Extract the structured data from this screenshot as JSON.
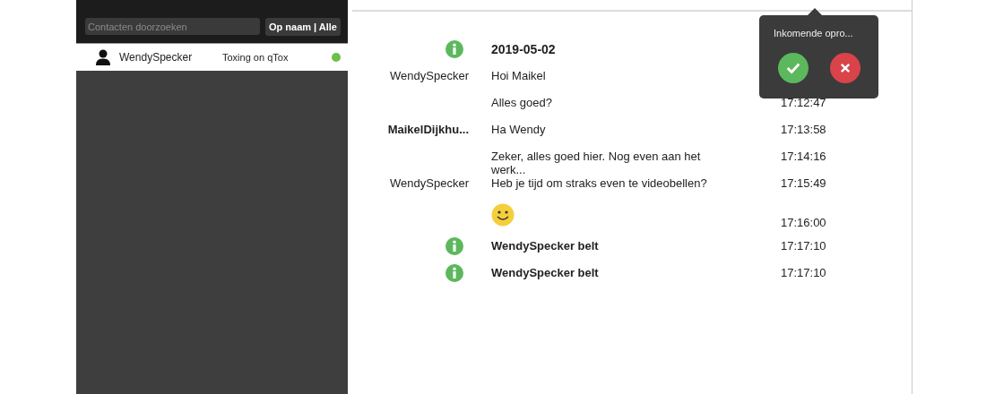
{
  "sidebar": {
    "search": {
      "placeholder": "Contacten doorzoeken"
    },
    "filter_button": "Op naam | Alle",
    "contacts": [
      {
        "name": "WendySpecker",
        "status": "Toxing on qTox",
        "online": true,
        "selected": true
      }
    ]
  },
  "chat": {
    "messages": [
      {
        "kind": "info",
        "text": "2019-05-02"
      },
      {
        "kind": "text",
        "sender": "WendySpecker",
        "self": false,
        "text": "Hoi Maikel"
      },
      {
        "kind": "text",
        "text": "Alles goed?",
        "time": "17:12:47"
      },
      {
        "kind": "text",
        "sender": "MaikelDijkhu...",
        "self": true,
        "text": "Ha Wendy",
        "time": "17:13:58"
      },
      {
        "kind": "text",
        "text": "Zeker, alles goed hier. Nog even aan het werk...",
        "time": "17:14:16"
      },
      {
        "kind": "text",
        "sender": "WendySpecker",
        "self": false,
        "text": "Heb je tijd om straks even te videobellen?",
        "time": "17:15:49"
      },
      {
        "kind": "emoji",
        "time": "17:16:00"
      },
      {
        "kind": "info",
        "text": "WendySpecker belt",
        "time": "17:17:10"
      },
      {
        "kind": "info",
        "text": "WendySpecker belt",
        "time": "17:17:10"
      }
    ]
  },
  "call_popup": {
    "title": "Inkomende opro..."
  }
}
